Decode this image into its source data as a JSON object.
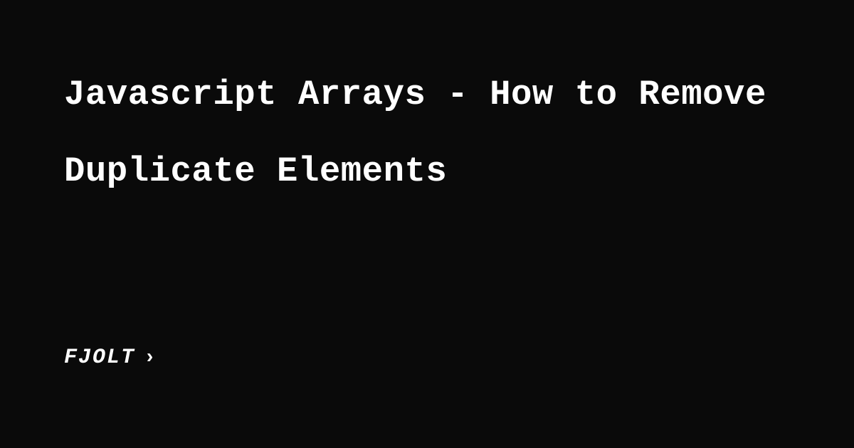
{
  "title": "Javascript Arrays - How to Remove Duplicate Elements",
  "brand": {
    "name": "FJOLT",
    "chevron": "›"
  }
}
